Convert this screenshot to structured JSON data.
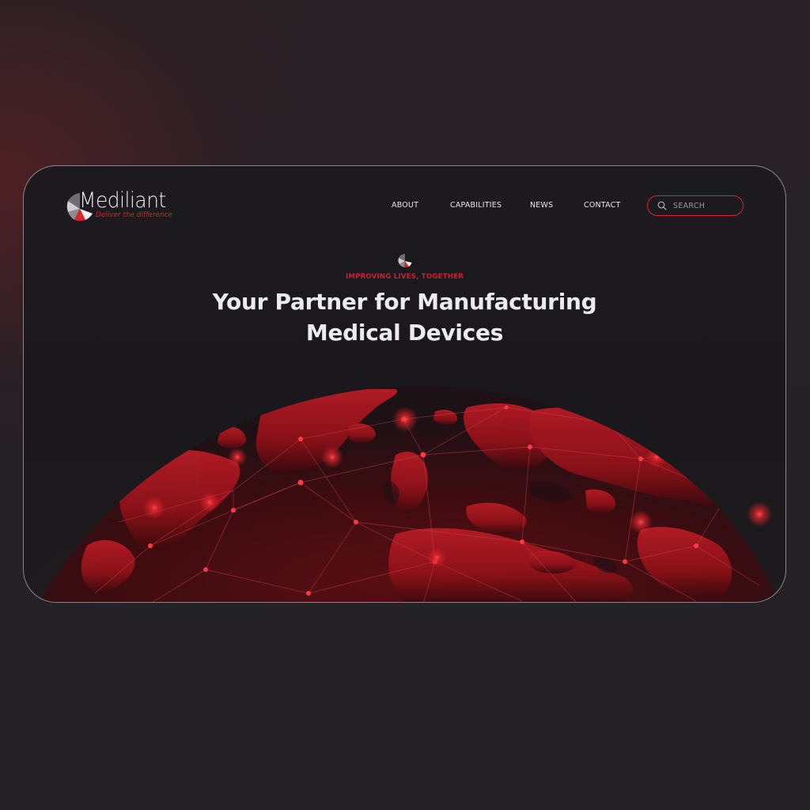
{
  "brand": {
    "name": "Mediliant",
    "tagline": "Deliver the difference",
    "accent_color": "#d8252c"
  },
  "nav": {
    "items": [
      {
        "label": "ABOUT"
      },
      {
        "label": "CAPABILITIES"
      },
      {
        "label": "NEWS"
      },
      {
        "label": "CONTACT"
      }
    ]
  },
  "search": {
    "placeholder": "SEARCH",
    "icon": "search-icon"
  },
  "hero": {
    "eyebrow": "IMPROVING LIVES, TOGETHER",
    "title_line1": "Your Partner for Manufacturing",
    "title_line2": "Medical Devices",
    "background": "globe-network-illustration"
  }
}
